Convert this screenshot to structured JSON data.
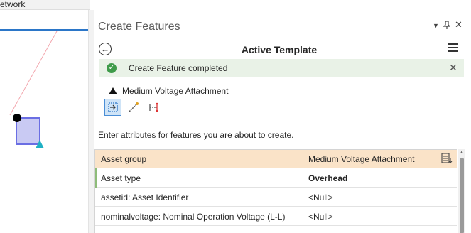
{
  "map_tab": {
    "top_label": "etwork",
    "dropdown_icon": "chevron-down-icon"
  },
  "pane": {
    "title": "Create Features",
    "header_icons": [
      "options-dropdown-icon",
      "pin-icon",
      "close-icon"
    ],
    "template_title": "Active Template",
    "back_icon": "back-arrow-icon",
    "menu_icon": "hamburger-menu-icon",
    "notice": {
      "text": "Create Feature completed",
      "icon": "check-circle-icon",
      "close_icon": "close-icon",
      "color": "#3f9b4a"
    },
    "feature_name": "Medium Voltage Attachment",
    "tools": [
      {
        "name": "attachment-tool-icon",
        "active": true
      },
      {
        "name": "line-tool-icon",
        "active": false
      },
      {
        "name": "split-line-tool-icon",
        "active": false
      }
    ],
    "instruction": "Enter attributes for features you are about to create.",
    "table": {
      "header": {
        "name": "Asset group",
        "value": "Medium Voltage Attachment"
      },
      "rows": [
        {
          "name": "Asset type",
          "value": "Overhead"
        },
        {
          "name": "assetid: Asset Identifier",
          "value": "<Null>"
        },
        {
          "name": "nominalvoltage: Nominal Operation Voltage (L-L)",
          "value": "<Null>"
        }
      ]
    }
  },
  "colors": {
    "accent": "#2b76c8",
    "header_row": "#fae3c8",
    "notice_bg": "#e9f2e7",
    "feature_fill": "#c9caf3",
    "feature_stroke": "#6a6ee3",
    "vertex_marker": "#1fb0c4"
  }
}
